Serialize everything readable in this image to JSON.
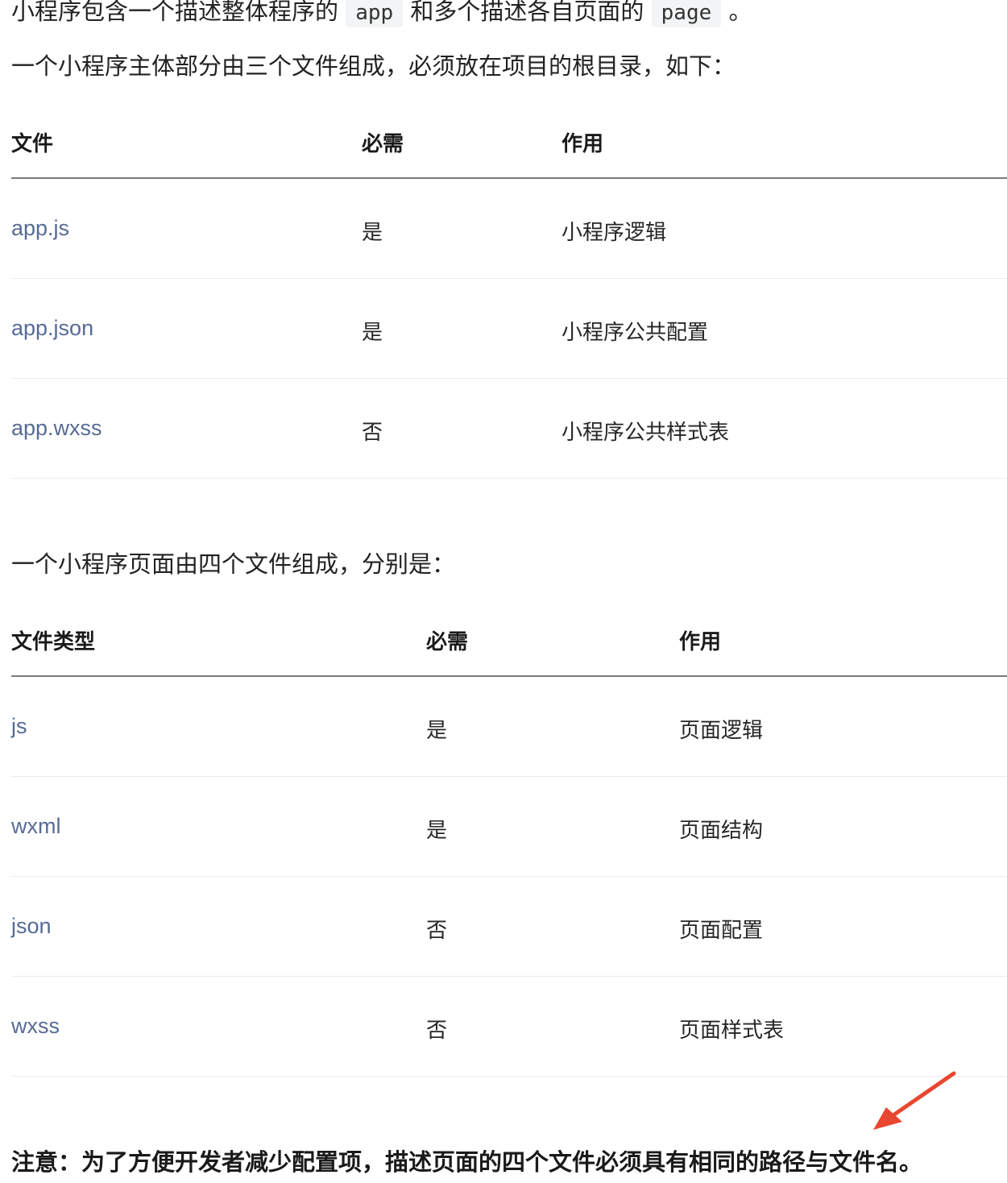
{
  "intro": {
    "before_app": "小程序包含一个描述整体程序的",
    "app_code": "app",
    "between": "和多个描述各自页面的",
    "page_code": "page",
    "end": "。"
  },
  "main_files_intro": "一个小程序主体部分由三个文件组成，必须放在项目的根目录，如下：",
  "table_main": {
    "headers": [
      "文件",
      "必需",
      "作用"
    ],
    "rows": [
      [
        "app.js",
        "是",
        "小程序逻辑"
      ],
      [
        "app.json",
        "是",
        "小程序公共配置"
      ],
      [
        "app.wxss",
        "否",
        "小程序公共样式表"
      ]
    ]
  },
  "page_files_intro": "一个小程序页面由四个文件组成，分别是：",
  "table_page": {
    "headers": [
      "文件类型",
      "必需",
      "作用"
    ],
    "rows": [
      [
        "js",
        "是",
        "页面逻辑"
      ],
      [
        "wxml",
        "是",
        "页面结构"
      ],
      [
        "json",
        "否",
        "页面配置"
      ],
      [
        "wxss",
        "否",
        "页面样式表"
      ]
    ]
  },
  "note": "注意：为了方便开发者减少配置项，描述页面的四个文件必须具有相同的路径与文件名。",
  "colors": {
    "link": "#576b95",
    "annotation_arrow": "#e8472f"
  },
  "annotation": {
    "icon": "red-arrow-icon"
  }
}
